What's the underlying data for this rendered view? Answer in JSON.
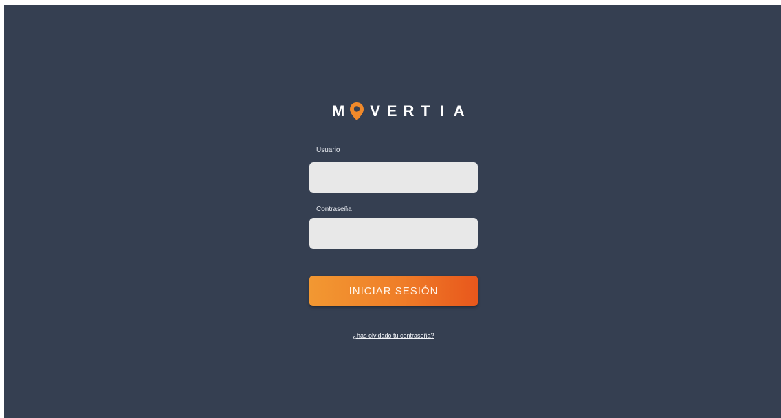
{
  "app": {
    "logo_letters": [
      "M",
      "V",
      "E",
      "R",
      "T",
      "I",
      "A"
    ],
    "logo_icon": "map-pin-icon",
    "accent_color": "#ef7d28",
    "background_color": "#353f51"
  },
  "form": {
    "username_label": "Usuario",
    "username_value": "",
    "password_label": "Contraseña",
    "password_value": "",
    "submit_label": "INICIAR SESIÓN",
    "forgot_password_link": "¿has olvidado tu contraseña?"
  }
}
